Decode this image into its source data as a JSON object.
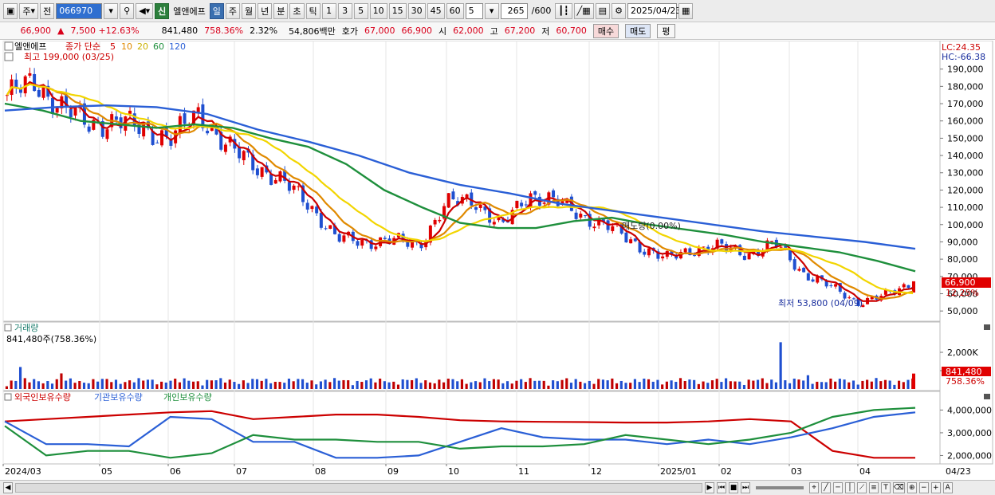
{
  "toolbar": {
    "period": "주",
    "mode": "전",
    "code": "066970",
    "tag": "신",
    "stock_name": "엘앤에프",
    "tf": [
      "일",
      "주",
      "월",
      "년",
      "분",
      "초",
      "틱"
    ],
    "tf_active": "일",
    "nums": [
      "1",
      "3",
      "5",
      "10",
      "15",
      "30",
      "45",
      "60"
    ],
    "sel_num": "5",
    "count": "265",
    "total": "/600",
    "date": "2025/04/23"
  },
  "quote": {
    "price": "66,900",
    "change": "7,500 +12.63%",
    "volume": "841,480",
    "vol_ratio": "758.36%",
    "turnover_rate": "2.32%",
    "amount": "54,806백만",
    "bid_label": "호가",
    "bid": "67,000",
    "bid2": "66,900",
    "open_label": "시",
    "open": "62,000",
    "high_label": "고",
    "high": "67,200",
    "low_label": "저",
    "low": "60,700",
    "buy": "매수",
    "sell": "매도",
    "eval": "평"
  },
  "price_pane": {
    "name": "엘앤에프",
    "ma_label": "종가 단순",
    "ma_periods": [
      "5",
      "10",
      "20",
      "60",
      "120"
    ],
    "ma_colors": [
      "#cc0000",
      "#e08a00",
      "#f2d500",
      "#1e8f3c",
      "#2a5fd6"
    ],
    "high_note": "최고 199,000 (03/25)",
    "low_note": "최저 53,800 (04/09)",
    "mid_note": "매도량(0.00%)",
    "lc": "LC:24.35",
    "hc": "HC:-66.38",
    "price_tag": "66,900",
    "pct_tag": "12.25%"
  },
  "volume_pane": {
    "title": "거래량",
    "value": "841,480주(758.36%)",
    "tag": "841,480",
    "tag_pct": "758.36%"
  },
  "holders_pane": {
    "labels": [
      "외국인보유수량",
      "기관보유수량",
      "개인보유수량"
    ],
    "colors": [
      "#cc0000",
      "#2a5fd6",
      "#1e8f3c"
    ]
  },
  "chart_data": [
    {
      "type": "candlestick",
      "title": "엘앤에프",
      "x": [
        "2024/03",
        "05",
        "06",
        "07",
        "08",
        "09",
        "10",
        "11",
        "12",
        "2025/01",
        "02",
        "03",
        "04",
        "04/23"
      ],
      "ylim": [
        45000,
        200000
      ],
      "y_ticks": [
        "190,000",
        "180,000",
        "170,000",
        "160,000",
        "150,000",
        "140,000",
        "130,000",
        "120,000",
        "110,000",
        "100,000",
        "90,000",
        "80,000",
        "70,000",
        "60,000",
        "50,000"
      ],
      "close": [
        175000,
        182000,
        168000,
        158000,
        160000,
        155000,
        150000,
        165000,
        145000,
        135000,
        125000,
        112000,
        92000,
        90000,
        91000,
        88000,
        112000,
        115000,
        98000,
        118000,
        113000,
        105000,
        98000,
        88000,
        80000,
        86000,
        87000,
        83000,
        89000,
        72000,
        64000,
        55000,
        59000,
        66900
      ],
      "ma_series": [
        {
          "name": "60",
          "values": [
            170000,
            166000,
            160000,
            158000,
            156000,
            158000,
            156000,
            150000,
            145000,
            135000,
            120000,
            110000,
            101000,
            98000,
            98000,
            102000,
            104000,
            100000,
            97000,
            94000,
            90000,
            87000,
            84000,
            79000,
            73000
          ]
        },
        {
          "name": "120",
          "values": [
            166000,
            168000,
            169000,
            168000,
            164000,
            155000,
            148000,
            140000,
            130000,
            123000,
            118000,
            112000,
            108000,
            104000,
            100000,
            96000,
            93000,
            90000,
            86000
          ]
        }
      ]
    },
    {
      "type": "bar",
      "title": "거래량",
      "y_ticks": [
        "2,000K",
        "1,000K"
      ],
      "ylim": [
        0,
        3000000
      ],
      "last_value": 841480
    },
    {
      "type": "line",
      "title": "보유수량",
      "y_ticks": [
        "4,000,000",
        "3,000,000",
        "2,000,000"
      ],
      "ylim": [
        1700000,
        4400000
      ],
      "series": [
        {
          "name": "외국인보유수량",
          "values": [
            3500000,
            3600000,
            3700000,
            3800000,
            3900000,
            3950000,
            3600000,
            3700000,
            3800000,
            3800000,
            3700000,
            3550000,
            3500000,
            3480000,
            3470000,
            3450000,
            3450000,
            3500000,
            3600000,
            3500000,
            2200000,
            1900000,
            1900000
          ]
        },
        {
          "name": "기관보유수량",
          "values": [
            3500000,
            2500000,
            2500000,
            2400000,
            3700000,
            3600000,
            2600000,
            2600000,
            1900000,
            1900000,
            2000000,
            2600000,
            3200000,
            2800000,
            2700000,
            2700000,
            2500000,
            2700000,
            2500000,
            2800000,
            3200000,
            3700000,
            3900000
          ]
        },
        {
          "name": "개인보유수량",
          "values": [
            3300000,
            2000000,
            2200000,
            2200000,
            1900000,
            2100000,
            2900000,
            2700000,
            2700000,
            2600000,
            2600000,
            2300000,
            2400000,
            2400000,
            2500000,
            2900000,
            2700000,
            2500000,
            2700000,
            3000000,
            3700000,
            4000000,
            4100000
          ]
        }
      ]
    }
  ]
}
